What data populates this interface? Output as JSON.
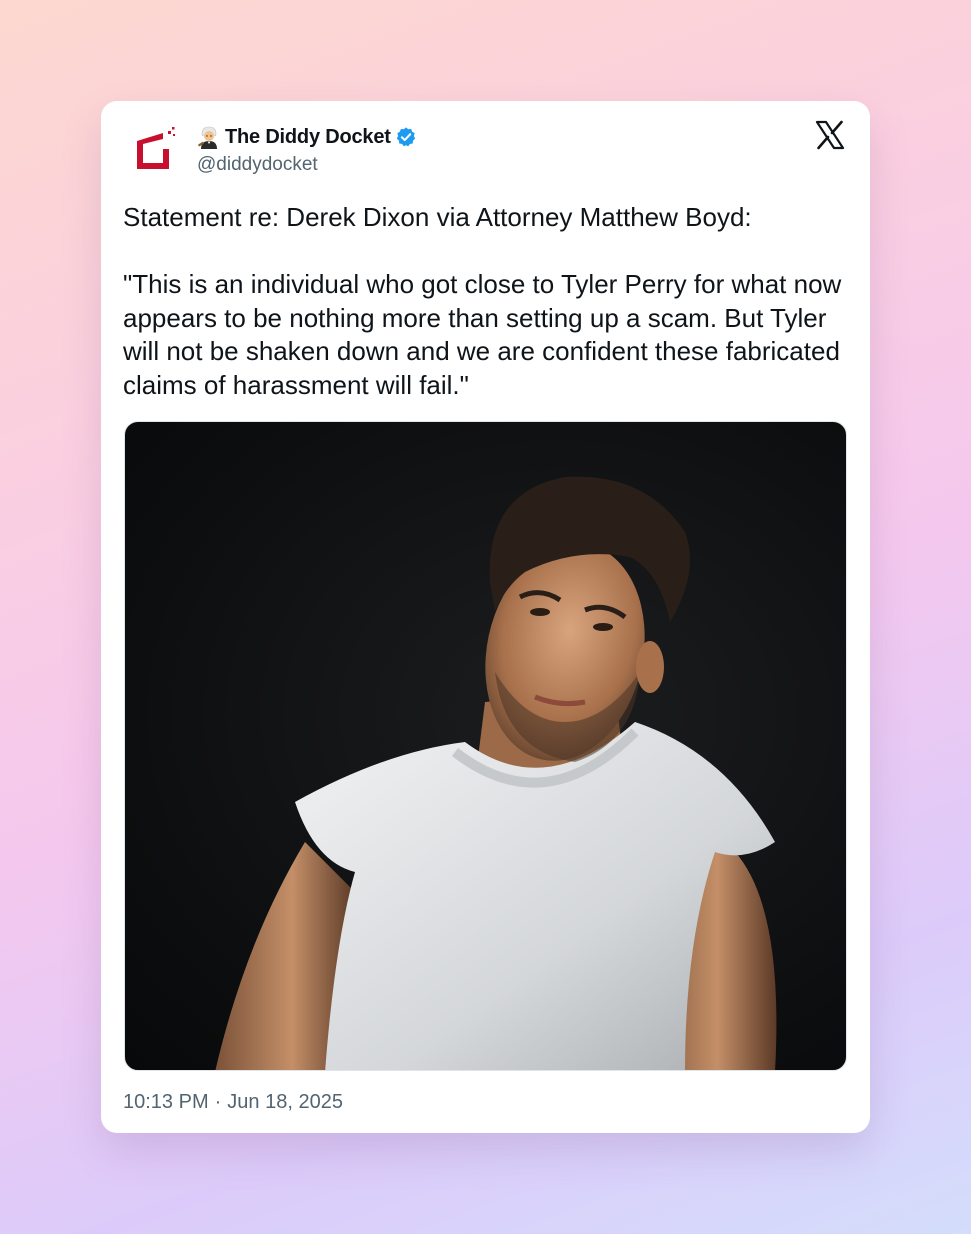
{
  "tweet": {
    "author": {
      "display_name": "The Diddy Docket",
      "handle": "@diddydocket",
      "verified": true,
      "avatar_icon": "red-docket-logo-icon",
      "name_emoji_icon": "judge-emoji-icon"
    },
    "platform_icon": "x-logo-icon",
    "text": {
      "line1": "Statement re: Derek Dixon via Attorney Matthew Boyd:",
      "quote": "\"This is an individual who got close to Tyler Perry for what now appears to be nothing more than setting up a scam. But Tyler will not be shaken down and we are confident these fabricated claims of harassment will fail.\""
    },
    "media": {
      "type": "photo"
    },
    "timestamp": {
      "time": "10:13 PM",
      "separator": "·",
      "date": "Jun 18, 2025"
    }
  },
  "colors": {
    "verified_blue": "#1d9bf0",
    "brand_red": "#c8102e",
    "text_primary": "#0f1419",
    "text_secondary": "#536471"
  }
}
